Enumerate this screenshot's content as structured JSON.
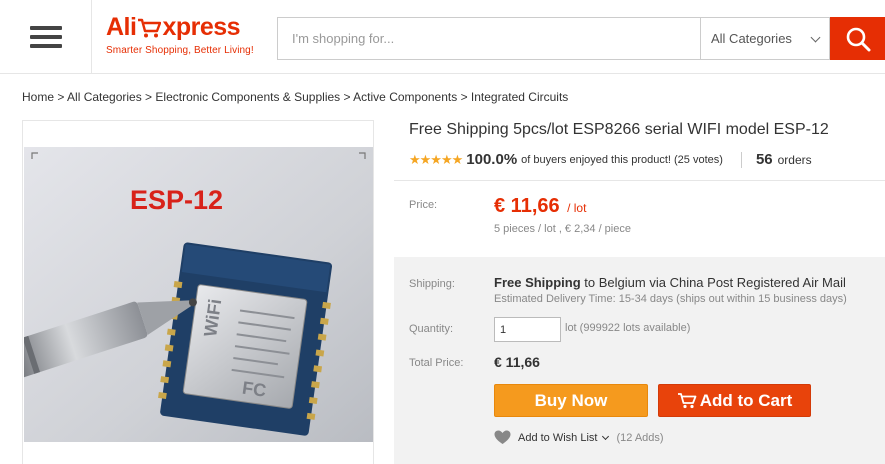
{
  "header": {
    "logo_text_a": "Ali",
    "logo_text_b": "xpress",
    "tagline": "Smarter Shopping, Better Living!",
    "search_placeholder": "I'm shopping for...",
    "category_label": "All Categories"
  },
  "breadcrumb": "Home > All Categories > Electronic Components & Supplies > Active Components > Integrated Circuits",
  "product": {
    "image_label": "ESP-12",
    "title": "Free Shipping 5pcs/lot ESP8266 serial WIFI model ESP-12",
    "rating": {
      "percent": "100.0%",
      "text": "of buyers enjoyed this product! (25 votes)",
      "orders_count": "56",
      "orders_label": "orders",
      "stars": 5
    },
    "price": {
      "label": "Price:",
      "value": "€ 11,66",
      "unit": "/ lot",
      "sub": "5 pieces / lot , € 2,34 / piece"
    },
    "shipping": {
      "label": "Shipping:",
      "method": "Free Shipping",
      "to_text": "to",
      "destination": "Belgium via China Post Registered Air Mail",
      "estimate": "Estimated Delivery Time: 15-34 days (ships out within 15 business days)"
    },
    "quantity": {
      "label": "Quantity:",
      "value": "1",
      "note": "lot (999922 lots available)"
    },
    "total": {
      "label": "Total Price:",
      "value": "€ 11,66"
    },
    "buttons": {
      "buy_now": "Buy Now",
      "add_to_cart": "Add to Cart"
    },
    "wish_list": {
      "label": "Add to Wish List",
      "adds": "(12 Adds)"
    }
  },
  "colors": {
    "brand": "#e62e04",
    "buy_now": "#f59a1e",
    "add_to_cart": "#e8430b",
    "stars": "#f5a623"
  }
}
